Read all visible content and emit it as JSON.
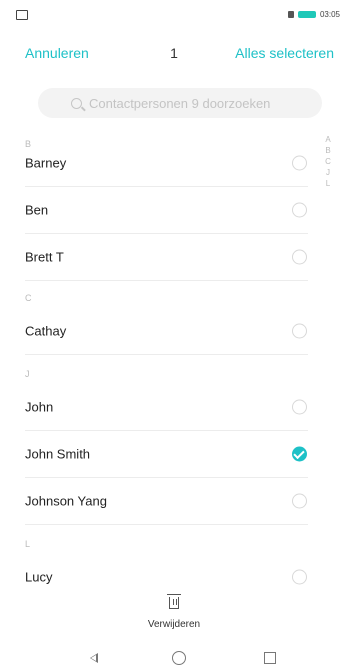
{
  "status_bar": {
    "time": "03:05"
  },
  "topbar": {
    "cancel_label": "Annuleren",
    "selected_count": "1",
    "select_all_label": "Alles selecteren"
  },
  "search": {
    "placeholder": "Contactpersonen 9 doorzoeken"
  },
  "sections": {
    "B": {
      "header": "B",
      "items": [
        "Barney",
        "Ben",
        "Brett T"
      ]
    },
    "C": {
      "header": "C",
      "items": [
        "Cathay"
      ]
    },
    "J": {
      "header": "J",
      "items": [
        "John",
        "John Smith",
        "Johnson Yang"
      ]
    },
    "L": {
      "header": "L",
      "items": [
        "Lucy"
      ]
    }
  },
  "selected_contacts": [
    "John Smith"
  ],
  "index_letters": [
    "A",
    "B",
    "C",
    "J",
    "L"
  ],
  "bottom_action": {
    "delete_label": "Verwijderen"
  },
  "colors": {
    "accent": "#1ec1c7",
    "battery": "#1fc8b8"
  },
  "icons": [
    "search-icon",
    "trash-icon",
    "back-icon",
    "home-icon",
    "recent-apps-icon"
  ]
}
